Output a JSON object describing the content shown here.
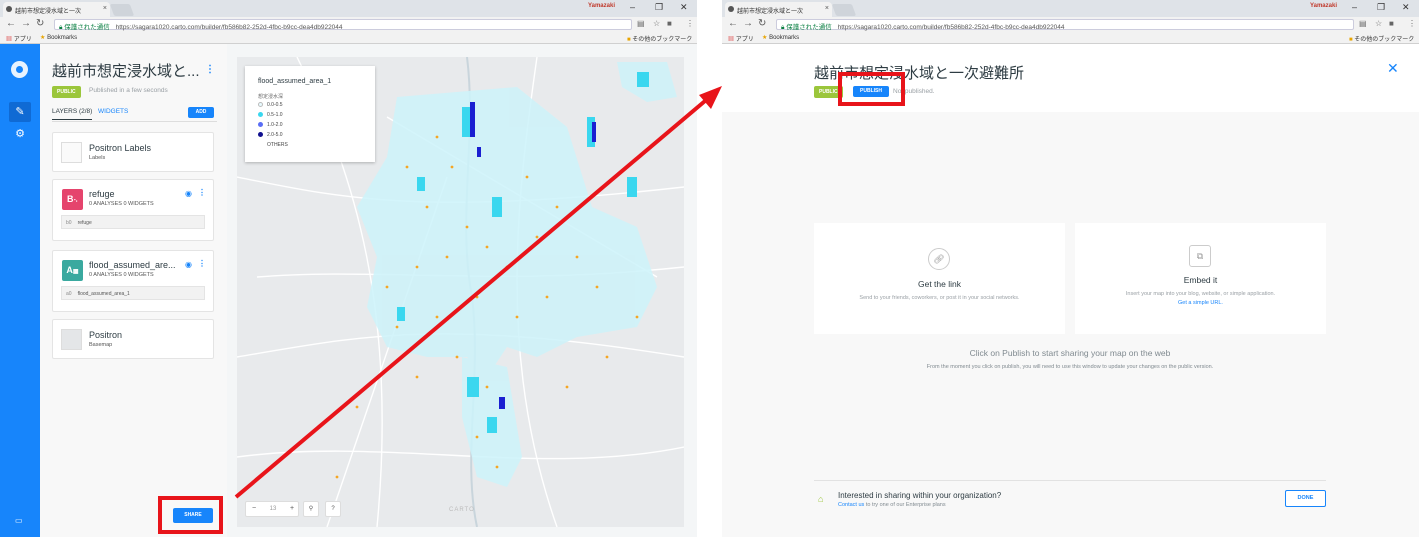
{
  "left": {
    "tab_title": "越前市想定浸水域と一次",
    "user": "Yamazaki",
    "secure_label": "保護された通信",
    "url": "https://sagara1020.carto.com/builder/fb586b82-252d-4fbc-b9cc-dea4db922044",
    "bookmarks": {
      "apps": "アプリ",
      "bookmarks": "Bookmarks",
      "other": "その他のブックマーク"
    },
    "map_title": "越前市想定浸水域と...",
    "public_badge": "PUBLIC",
    "published_note": "Published in a few seconds",
    "layers_tab": "LAYERS (2/8)",
    "widgets_tab": "WIDGETS",
    "add_button": "ADD",
    "layers": [
      {
        "name": "Positron Labels",
        "sub": "Labels"
      },
      {
        "letter": "B",
        "name": "refuge",
        "sub": "0 ANALYSES   0 WIDGETS",
        "source_key": "b0",
        "source": "refuge",
        "color": "#e5446d"
      },
      {
        "letter": "A",
        "name": "flood_assumed_are...",
        "sub": "0 ANALYSES   0 WIDGETS",
        "source_key": "a0",
        "source": "flood_assumed_area_1",
        "color": "#3aa99f"
      },
      {
        "name": "Positron",
        "sub": "Basemap"
      }
    ],
    "legend": {
      "title": "flood_assumed_area_1",
      "subtitle": "想定浸水深",
      "items": [
        {
          "label": "0.0-0.5",
          "color": "#e8fbff"
        },
        {
          "label": "0.5-1.0",
          "color": "#3ad7ef"
        },
        {
          "label": "1.0-2.0",
          "color": "#5a6ef5"
        },
        {
          "label": "2.0-5.0",
          "color": "#10108f"
        },
        {
          "label": "OTHERS",
          "color": "#ffffff"
        }
      ]
    },
    "zoom_level": "13",
    "zoom_out": "−",
    "zoom_in": "+",
    "search_btn": "⚲",
    "help_btn": "?",
    "carto_watermark": "CARTO",
    "share_button": "SHARE"
  },
  "right": {
    "tab_title": "越前市想定浸水域と一次",
    "user": "Yamazaki",
    "secure_label": "保護された通信",
    "url": "https://sagara1020.carto.com/builder/fb586b82-252d-4fbc-b9cc-dea4db922044",
    "bookmarks": {
      "apps": "アプリ",
      "bookmarks": "Bookmarks",
      "other": "その他のブックマーク"
    },
    "modal_title": "越前市想定浸水域と一次避難所",
    "public_badge": "PUBLIC",
    "publish_button": "PUBLISH",
    "not_published": "Not published.",
    "cards": [
      {
        "icon": "link-icon",
        "title": "Get the link",
        "desc": "Send to your friends, coworkers, or post it in your social networks.",
        "link": ""
      },
      {
        "icon": "embed-icon",
        "title": "Embed it",
        "desc": "Insert your map into your blog, website, or simple application.",
        "link": "Get a simple URL."
      }
    ],
    "main_text": "Click on Publish to start sharing your map on the web",
    "sub_text": "From the moment you click on publish, you will need to use this window to update your changes on the public version.",
    "org_question": "Interested in sharing within your organization?",
    "org_link": "Contact us",
    "org_rest": "to try one of our Enterprise plans",
    "done_button": "DONE"
  },
  "accent_color": "#1785fb",
  "annotation_color": "#e8141a"
}
